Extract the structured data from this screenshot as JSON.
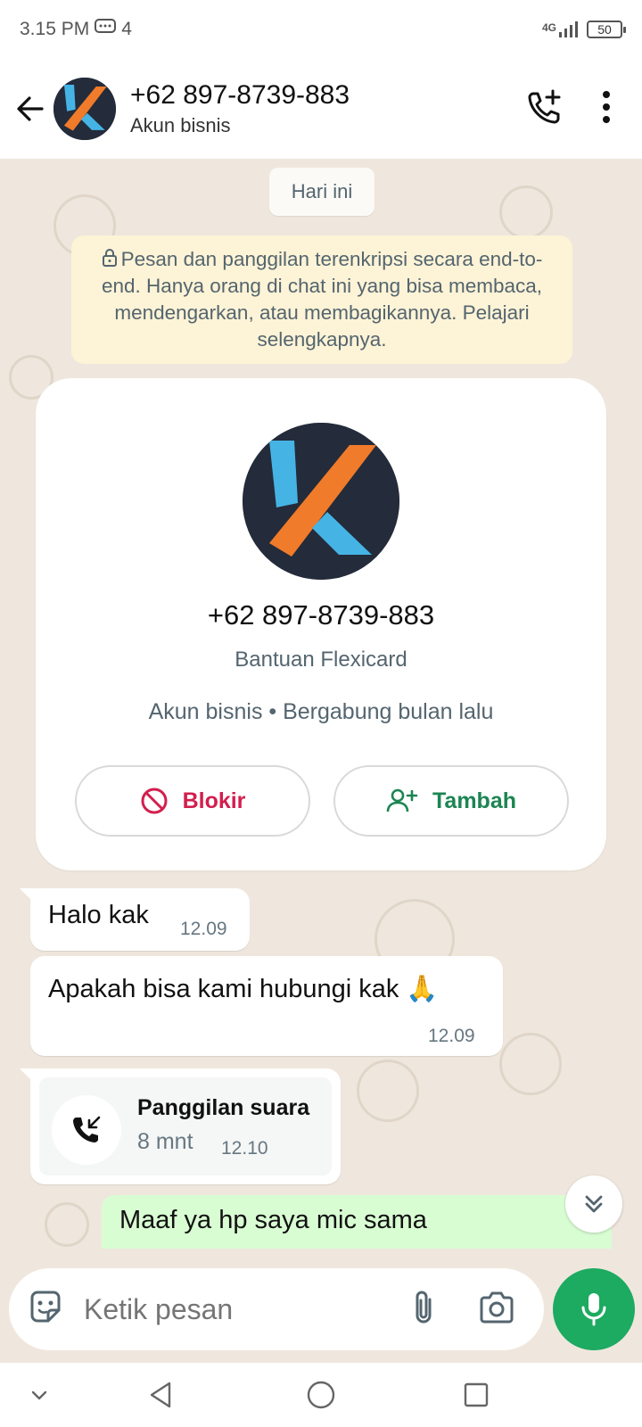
{
  "status_bar": {
    "time": "3.15 PM",
    "notification_count": "4",
    "network": "4G",
    "battery": "50"
  },
  "header": {
    "title": "+62 897-8739-883",
    "subtitle": "Akun bisnis"
  },
  "chat": {
    "date_chip": "Hari ini",
    "encryption_notice": "Pesan dan panggilan terenkripsi secara end-to-end. Hanya orang di chat ini yang bisa membaca, mendengarkan, atau membagikannya. Pelajari selengkapnya.",
    "profile_card": {
      "phone": "+62 897-8739-883",
      "name": "Bantuan Flexicard",
      "meta": "Akun bisnis • Bergabung bulan lalu",
      "block_label": "Blokir",
      "add_label": "Tambah"
    },
    "messages": [
      {
        "text": "Halo kak",
        "time": "12.09"
      },
      {
        "text": "Apakah bisa kami hubungi kak 🙏",
        "time": "12.09"
      }
    ],
    "call": {
      "title": "Panggilan suara",
      "duration": "8 mnt",
      "time": "12.10"
    },
    "outgoing": {
      "text": "Maaf ya hp saya mic sama"
    }
  },
  "composer": {
    "placeholder": "Ketik pesan"
  },
  "colors": {
    "accent_green": "#1daa61",
    "block_red": "#d21f4e",
    "add_green": "#1c8553",
    "logo_orange": "#f07b2a",
    "logo_blue": "#45b4e5",
    "logo_bg": "#242b3a"
  }
}
